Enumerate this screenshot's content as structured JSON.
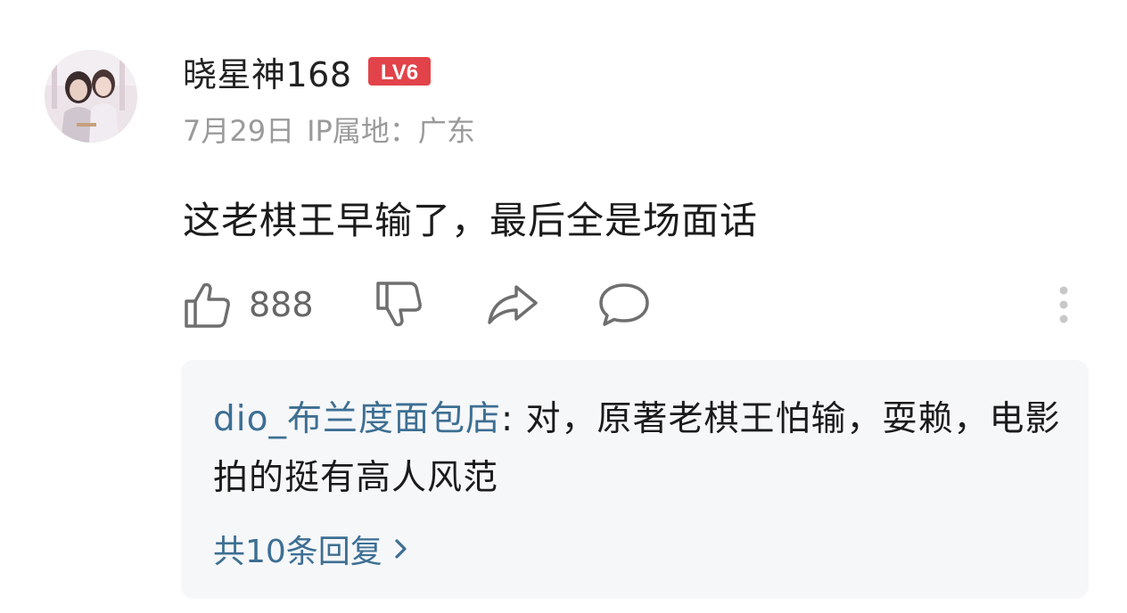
{
  "comment": {
    "username": "晓星神168",
    "level_badge": "LV6",
    "date": "7月29日",
    "ip_location": "IP属地：广东",
    "text": "这老棋王早输了，最后全是场面话",
    "like_count": "888"
  },
  "icons": {
    "like": "thumbs-up-icon",
    "dislike": "thumbs-down-icon",
    "share": "share-arrow-icon",
    "reply": "speech-bubble-icon",
    "more": "vertical-dots-icon"
  },
  "colors": {
    "level_badge": "#e2434a",
    "reply_author": "#3d6f93",
    "meta_text": "#9a9a9a",
    "replies_background": "#f6f7f9"
  },
  "replies": {
    "preview": {
      "author": "dio_布兰度面包店",
      "separator": ": ",
      "text": "对，原著老棋王怕输，耍赖，电影拍的挺有高人风范"
    },
    "more_label": "共10条回复"
  }
}
